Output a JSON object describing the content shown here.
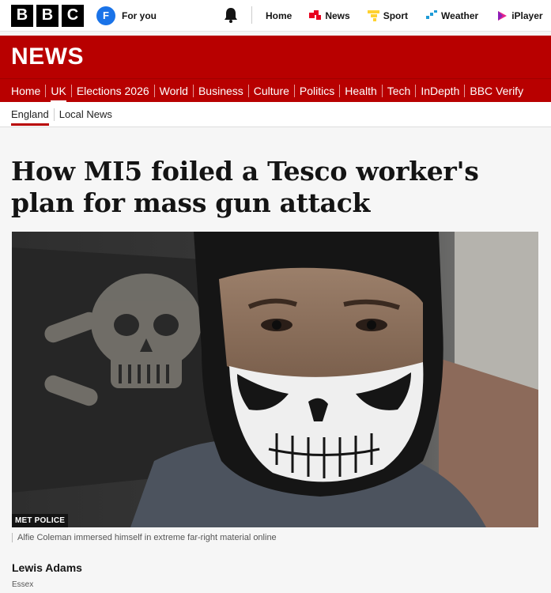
{
  "topbar": {
    "logo_letters": [
      "B",
      "B",
      "C"
    ],
    "account_initial": "F",
    "for_you_label": "For you",
    "nav": [
      {
        "label": "Home",
        "icon": "none"
      },
      {
        "label": "News",
        "icon": "news-icon"
      },
      {
        "label": "Sport",
        "icon": "sport-icon"
      },
      {
        "label": "Weather",
        "icon": "weather-icon"
      },
      {
        "label": "iPlayer",
        "icon": "iplayer-icon"
      }
    ]
  },
  "banner": {
    "title": "NEWS"
  },
  "section_nav": [
    {
      "label": "Home"
    },
    {
      "label": "UK"
    },
    {
      "label": "Elections 2026"
    },
    {
      "label": "World"
    },
    {
      "label": "Business"
    },
    {
      "label": "Culture"
    },
    {
      "label": "Politics"
    },
    {
      "label": "Health"
    },
    {
      "label": "Tech"
    },
    {
      "label": "InDepth"
    },
    {
      "label": "BBC Verify"
    }
  ],
  "sub_nav": [
    {
      "label": "England"
    },
    {
      "label": "Local News"
    }
  ],
  "article": {
    "headline": "How MI5 foiled a Tesco worker's plan for mass gun attack",
    "image_credit": "MET POLICE",
    "caption": "Alfie Coleman immersed himself in extreme far-right material online",
    "author": "Lewis Adams",
    "location": "Essex"
  },
  "colors": {
    "brand_red": "#b80000",
    "account_blue": "#1a73e8"
  }
}
